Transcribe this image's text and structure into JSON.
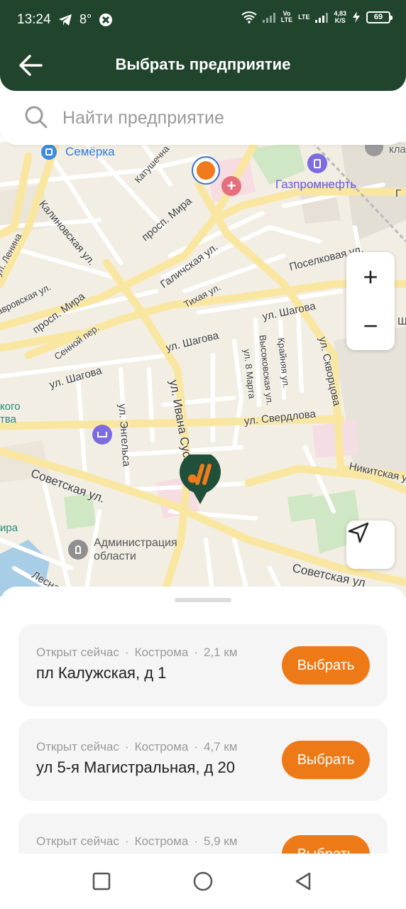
{
  "status_bar": {
    "time": "13:24",
    "temperature": "8°",
    "net_type": "Vo\nLTE",
    "lte": "LTE",
    "speed_value": "4,83",
    "speed_unit": "K/S",
    "battery": "69"
  },
  "header": {
    "title": "Выбрать предприятие",
    "background_color": "#21442d"
  },
  "search": {
    "placeholder": "Найти предприятие"
  },
  "map": {
    "labels": {
      "semerka": "Семёрка",
      "gazpromneft": "Газпромнефть",
      "administration_1": "Администрация",
      "administration_2": "области",
      "katushechnaya": "Катушечна",
      "prosp_mira_1": "просп. Мира",
      "prosp_mira_2": "просп. Мира",
      "kalinovskaya": "Калиновская ул.",
      "galichskaya": "Галичская ул.",
      "tikhaya": "Тихая ул.",
      "poselkovaya": "Поселковая ул.",
      "shagova_1": "ул. Шагова",
      "shagova_2": "ул. Шагова",
      "shagova_3": "ул. Шагова",
      "sennoy": "Сенной пер.",
      "lenina": "ул. Ленина",
      "lavrovskaya": "авровская ул.",
      "ivana_susanina": "ул. Ивана Сусанина",
      "vysokovskaya": "Высоковская ул.",
      "kraynyaya": "Крайняя ул.",
      "8_marta": "ул. 8 Марта",
      "skvortsova": "ул. Скворцова",
      "engelsa": "ул. Энгельса",
      "sverdlova": "ул. Свердлова",
      "sovetskaya_1": "Советская ул.",
      "sovetskaya_2": "Советская ул",
      "nikitskaya": "Никитская ул.",
      "lesnaya": "Лесна",
      "edge_kla": "кла",
      "edge_g": "Г",
      "edge_sh": "Ш",
      "edge_ul": "ул.",
      "edge_kogo_1": "кого",
      "edge_kogo_2": "тва",
      "edge_mira": "ира"
    },
    "zoom_in": "+",
    "zoom_out": "−",
    "accent_color": "#ee7a17"
  },
  "places": [
    {
      "status": "Открыт сейчас",
      "city": "Кострома",
      "distance": "2,1 км",
      "address": "пл Калужская, д 1",
      "button": "Выбрать"
    },
    {
      "status": "Открыт сейчас",
      "city": "Кострома",
      "distance": "4,7 км",
      "address": "ул 5-я Магистральная, д 20",
      "button": "Выбрать"
    },
    {
      "status": "Открыт сейчас",
      "city": "Кострома",
      "distance": "5,9 км",
      "address": "",
      "button": "Выбрать"
    }
  ],
  "dot": "·"
}
